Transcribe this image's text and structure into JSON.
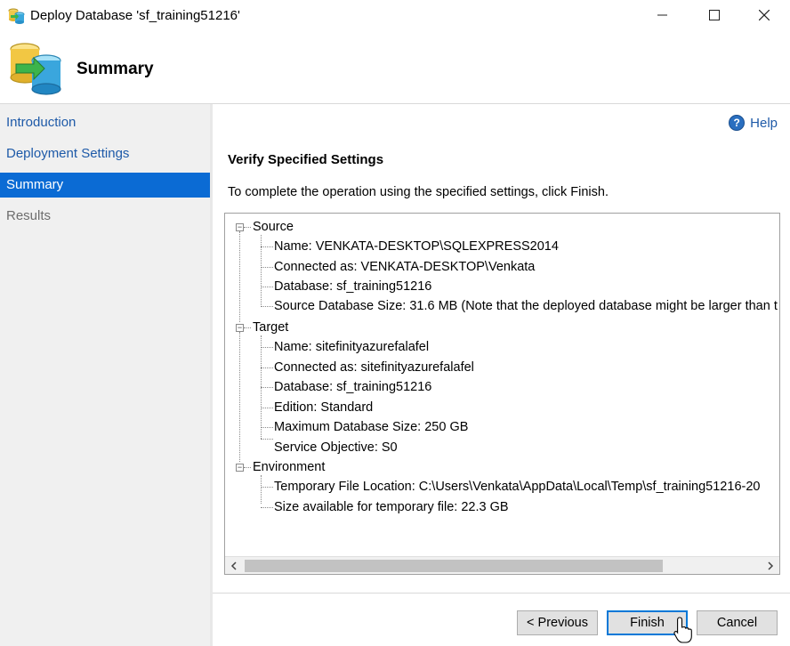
{
  "window": {
    "title": "Deploy Database 'sf_training51216'"
  },
  "header": {
    "title": "Summary"
  },
  "sidebar": {
    "items": [
      {
        "label": "Introduction"
      },
      {
        "label": "Deployment Settings"
      },
      {
        "label": "Summary"
      },
      {
        "label": "Results"
      }
    ]
  },
  "main": {
    "help_label": "Help",
    "section_title": "Verify Specified Settings",
    "instructions": "To complete the operation using the specified settings, click Finish."
  },
  "tree": {
    "source": {
      "label": "Source",
      "items": [
        "Name: VENKATA-DESKTOP\\SQLEXPRESS2014",
        "Connected as: VENKATA-DESKTOP\\Venkata",
        "Database: sf_training51216",
        "Source Database Size: 31.6 MB (Note that the deployed database might be larger than t"
      ]
    },
    "target": {
      "label": "Target",
      "items": [
        "Name: sitefinityazurefalafel",
        "Connected as: sitefinityazurefalafel",
        "Database: sf_training51216",
        "Edition: Standard",
        "Maximum Database Size: 250 GB",
        "Service Objective: S0"
      ]
    },
    "environment": {
      "label": "Environment",
      "items": [
        "Temporary File Location: C:\\Users\\Venkata\\AppData\\Local\\Temp\\sf_training51216-20",
        "Size available for temporary file: 22.3 GB"
      ]
    }
  },
  "buttons": {
    "previous": "< Previous",
    "finish": "Finish",
    "cancel": "Cancel"
  },
  "icons": {
    "app": "database-deploy-icon",
    "header": "database-migrate-icon",
    "help": "help-icon"
  },
  "colors": {
    "active_nav": "#0b6bd4",
    "link": "#1e5aa8",
    "sidebar_bg": "#f0f0f0"
  }
}
